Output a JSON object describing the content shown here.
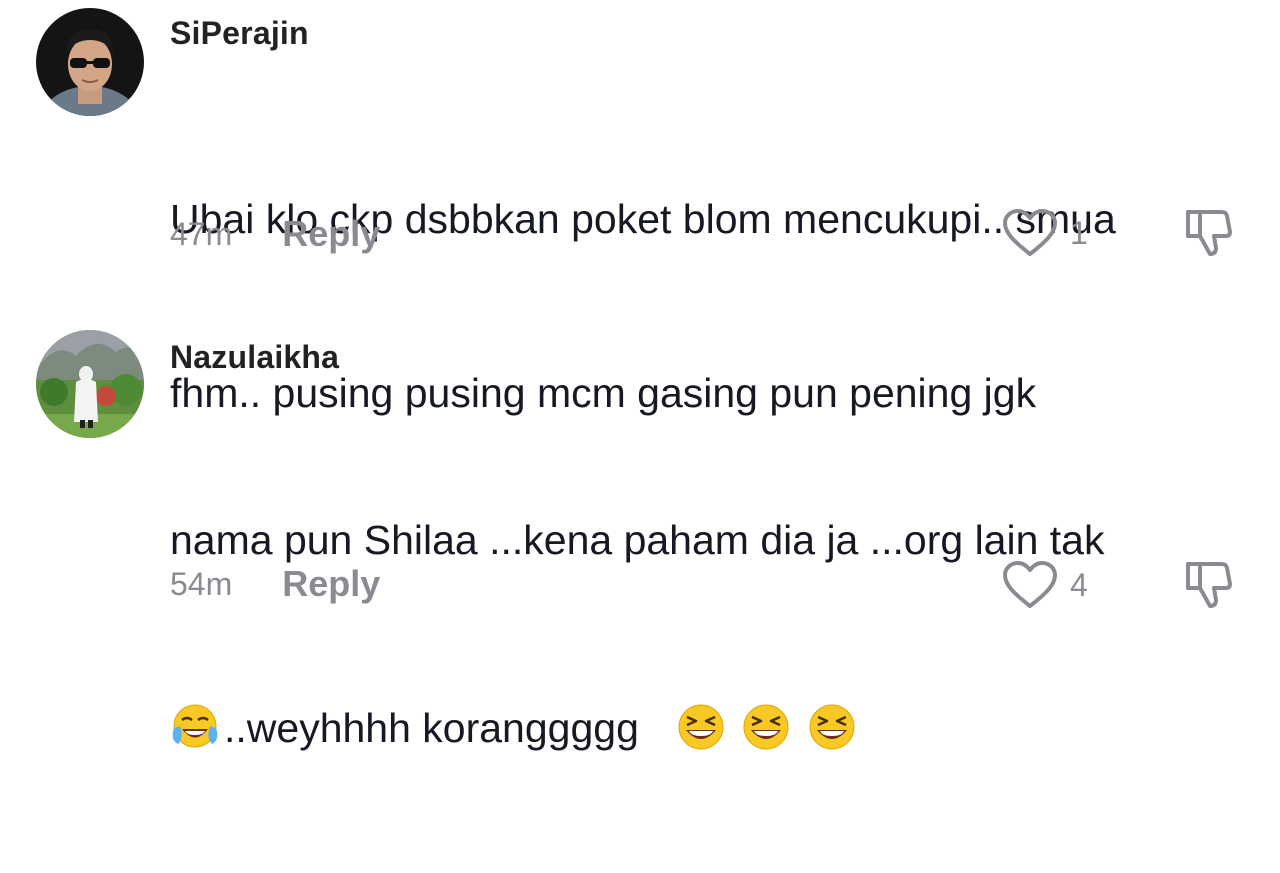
{
  "comments": [
    {
      "username": "SiPerajin",
      "lines": [
        "Ubai klo ckp dsbbkan poket blom mencukupi.. smua",
        "fhm.. pusing pusing mcm gasing pun pening jgk"
      ],
      "time": "47m",
      "reply_label": "Reply",
      "likes": "1",
      "avatar_icon": "profile-photo-man-sunglasses"
    },
    {
      "username": "Nazulaikha",
      "lines": [
        "nama pun Shilaa ...kena paham dia ja ...org lain tak",
        "..weyhhhh koranggggg"
      ],
      "emojis": {
        "leading": "face-with-tears-of-joy",
        "trailing": [
          "grinning-squinting-face",
          "grinning-squinting-face",
          "grinning-squinting-face"
        ]
      },
      "time": "54m",
      "reply_label": "Reply",
      "likes": "4",
      "avatar_icon": "profile-photo-person-garden"
    }
  ],
  "colors": {
    "text": "#161823",
    "muted": "#8a8b91",
    "background": "#ffffff"
  }
}
